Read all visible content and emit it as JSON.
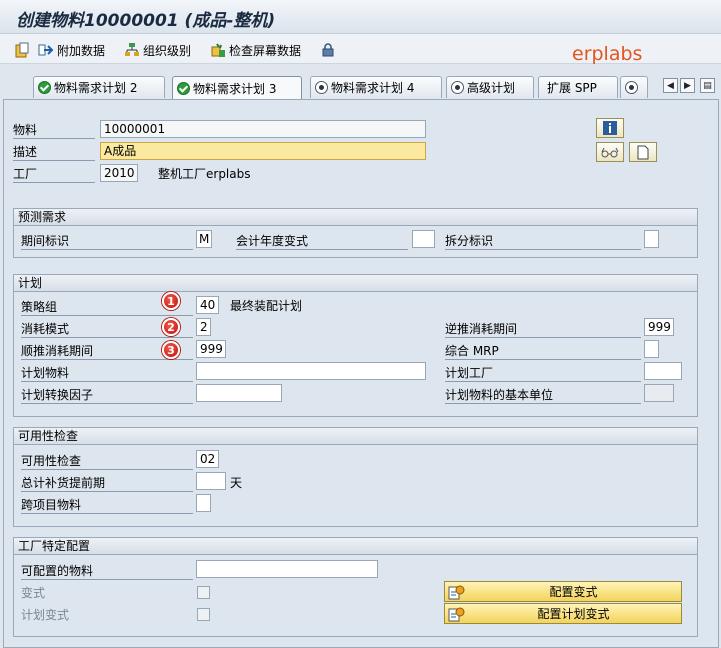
{
  "window": {
    "title": "创建物料10000001 (成品-整机)"
  },
  "toolbar": {
    "additional_data": "附加数据",
    "org_levels": "组织级别",
    "check_screen_data": "检查屏幕数据"
  },
  "watermark": "erplabs",
  "tabs": [
    {
      "label": "物料需求计划 2",
      "icon": "check-icon"
    },
    {
      "label": "物料需求计划 3",
      "icon": "check-icon",
      "active": true
    },
    {
      "label": "物料需求计划 4",
      "icon": "radio-icon"
    },
    {
      "label": "高级计划",
      "icon": "radio-icon"
    },
    {
      "label": "扩展 SPP",
      "icon": ""
    },
    {
      "label": "",
      "icon": "radio-icon"
    }
  ],
  "header": {
    "material_label": "物料",
    "material_value": "10000001",
    "desc_label": "描述",
    "desc_value": "A成品",
    "plant_label": "工厂",
    "plant_value": "2010",
    "plant_name": "整机工厂erplabs"
  },
  "forecast": {
    "title": "预测需求",
    "period_label": "期间标识",
    "period_value": "M",
    "fiscal_label": "会计年度变式",
    "fiscal_value": "",
    "split_label": "拆分标识",
    "split_value": ""
  },
  "planning": {
    "title": "计划",
    "strategy_label": "策略组",
    "strategy_value": "40",
    "strategy_text": "最终装配计划",
    "consumption_label": "消耗模式",
    "consumption_value": "2",
    "bwd_label": "逆推消耗期间",
    "bwd_value": "999",
    "fwd_label": "顺推消耗期间",
    "fwd_value": "999",
    "mixed_label": "综合 MRP",
    "mixed_value": "",
    "plan_mat_label": "计划物料",
    "plan_mat_value": "",
    "plan_plant_label": "计划工厂",
    "plan_plant_value": "",
    "conv_label": "计划转换因子",
    "conv_value": "",
    "base_unit_label": "计划物料的基本单位",
    "base_unit_value": "",
    "badges": [
      "1",
      "2",
      "3"
    ]
  },
  "availability": {
    "title": "可用性检查",
    "check_label": "可用性检查",
    "check_value": "02",
    "lead_label": "总计补货提前期",
    "lead_value": "",
    "lead_unit": "天",
    "cross_label": "跨项目物料",
    "cross_value": ""
  },
  "plant_config": {
    "title": "工厂特定配置",
    "configurable_label": "可配置的物料",
    "configurable_value": "",
    "variant_label": "变式",
    "plan_variant_label": "计划变式",
    "config_variant_btn": "配置变式",
    "config_plan_variant_btn": "配置计划变式"
  }
}
